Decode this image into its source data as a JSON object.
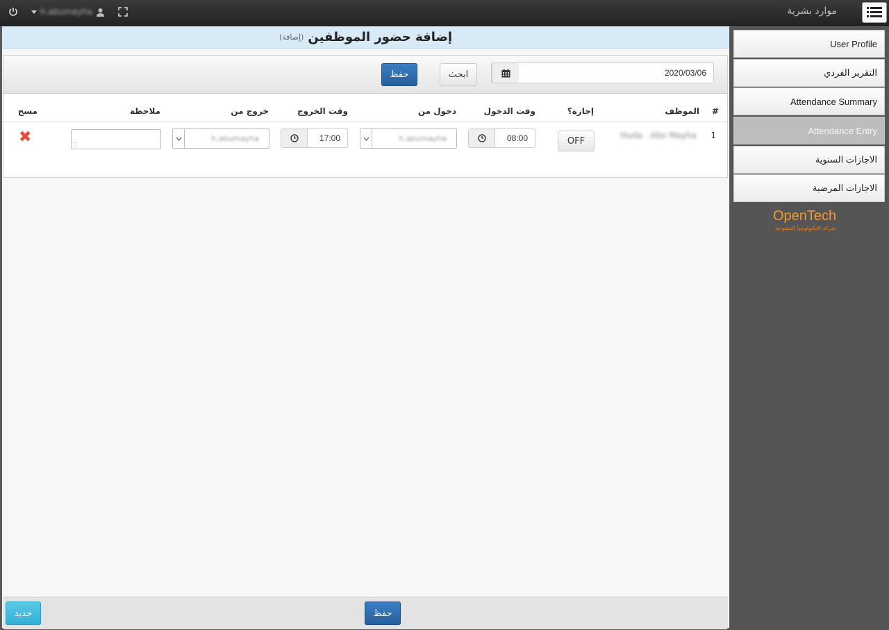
{
  "topbar": {
    "app_title": "موارد بشرية",
    "username": "h.abumayha"
  },
  "page": {
    "title": "إضافة حضور الموظفين",
    "subtitle": "(إضافة)"
  },
  "toolbar": {
    "date_value": "2020/03/06",
    "search_label": "ابحث",
    "save_label": "حفظ"
  },
  "table": {
    "headers": {
      "num": "#",
      "employee": "الموظف",
      "leave": "إجازة؟",
      "time_in": "وقت الدخول",
      "in_from": "دخول من",
      "time_out": "وقت الخروج",
      "out_from": "خروج من",
      "note": "ملاحظة",
      "delete": "مسح"
    },
    "rows": [
      {
        "num": "1",
        "employee": "Huda . Abo Mayha",
        "leave": "OFF",
        "time_in": "08:00",
        "in_from": "h.abumayha",
        "time_out": "17:00",
        "out_from": "h.abumayha",
        "note": ""
      }
    ]
  },
  "footer": {
    "save_label": "حفظ",
    "new_label": "جديد"
  },
  "sidebar": {
    "items": [
      {
        "label": "User Profile"
      },
      {
        "label": "التقرير الفردي"
      },
      {
        "label": "Attendance Summary"
      },
      {
        "label": "Attendance Entry"
      },
      {
        "label": "الاجازات السنوية"
      },
      {
        "label": "الاجازات المرضية"
      }
    ],
    "logo_text": "OpenTech",
    "logo_sub": "شركة التكنولوجيا المفتوحة"
  },
  "colors": {
    "primary": "#2a6aad",
    "info": "#31b0d5",
    "header_bg": "#d8eaf5",
    "danger": "#e74c3c",
    "brand": "#f39a2a"
  }
}
